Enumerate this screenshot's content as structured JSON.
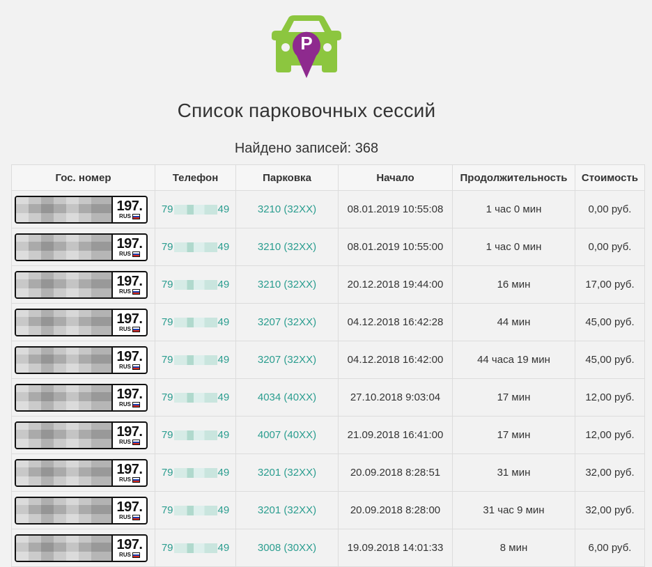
{
  "page": {
    "title": "Список парковочных сессий",
    "records_found": "Найдено записей: 368"
  },
  "table": {
    "headers": {
      "plate": "Гос. номер",
      "phone": "Телефон",
      "parking": "Парковка",
      "start": "Начало",
      "duration": "Продолжительность",
      "cost": "Стоимость"
    },
    "rows": [
      {
        "region": "197.",
        "country": "RUS",
        "phone_start": "79",
        "phone_end": "49",
        "parking": "3210 (32XX)",
        "start": "08.01.2019 10:55:08",
        "duration": "1 час 0 мин",
        "cost": "0,00 руб."
      },
      {
        "region": "197.",
        "country": "RUS",
        "phone_start": "79",
        "phone_end": "49",
        "parking": "3210 (32XX)",
        "start": "08.01.2019 10:55:00",
        "duration": "1 час 0 мин",
        "cost": "0,00 руб."
      },
      {
        "region": "197.",
        "country": "RUS",
        "phone_start": "79",
        "phone_end": "49",
        "parking": "3210 (32XX)",
        "start": "20.12.2018 19:44:00",
        "duration": "16 мин",
        "cost": "17,00 руб."
      },
      {
        "region": "197.",
        "country": "RUS",
        "phone_start": "79",
        "phone_end": "49",
        "parking": "3207 (32XX)",
        "start": "04.12.2018 16:42:28",
        "duration": "44 мин",
        "cost": "45,00 руб."
      },
      {
        "region": "197.",
        "country": "RUS",
        "phone_start": "79",
        "phone_end": "49",
        "parking": "3207 (32XX)",
        "start": "04.12.2018 16:42:00",
        "duration": "44 часа 19 мин",
        "cost": "45,00 руб."
      },
      {
        "region": "197.",
        "country": "RUS",
        "phone_start": "79",
        "phone_end": "49",
        "parking": "4034 (40XX)",
        "start": "27.10.2018 9:03:04",
        "duration": "17 мин",
        "cost": "12,00 руб."
      },
      {
        "region": "197.",
        "country": "RUS",
        "phone_start": "79",
        "phone_end": "49",
        "parking": "4007 (40XX)",
        "start": "21.09.2018 16:41:00",
        "duration": "17 мин",
        "cost": "12,00 руб."
      },
      {
        "region": "197.",
        "country": "RUS",
        "phone_start": "79",
        "phone_end": "49",
        "parking": "3201 (32XX)",
        "start": "20.09.2018 8:28:51",
        "duration": "31 мин",
        "cost": "32,00 руб."
      },
      {
        "region": "197.",
        "country": "RUS",
        "phone_start": "79",
        "phone_end": "49",
        "parking": "3201 (32XX)",
        "start": "20.09.2018 8:28:00",
        "duration": "31 час 9 мин",
        "cost": "32,00 руб."
      },
      {
        "region": "197.",
        "country": "RUS",
        "phone_start": "79",
        "phone_end": "49",
        "parking": "3008 (30XX)",
        "start": "19.09.2018 14:01:33",
        "duration": "8 мин",
        "cost": "6,00 руб."
      }
    ]
  },
  "icons": {
    "logo": "car-parking-pin-icon",
    "flag": "russia-flag-icon"
  },
  "colors": {
    "logo_green": "#8cc63f",
    "logo_purple": "#8e2a8e",
    "link": "#2a9d8f",
    "background": "#f2f2f2",
    "border": "#dcdcdc"
  }
}
